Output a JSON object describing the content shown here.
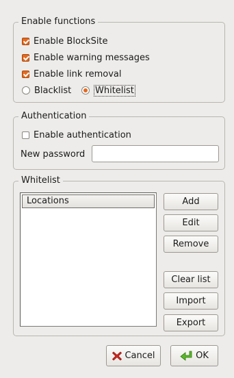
{
  "enable_functions": {
    "title": "Enable functions",
    "enable_blocksite": {
      "label": "Enable BlockSite",
      "checked": true
    },
    "enable_warning": {
      "label": "Enable warning messages",
      "checked": true
    },
    "enable_link_removal": {
      "label": "Enable link removal",
      "checked": true
    },
    "mode": {
      "blacklist_label": "Blacklist",
      "whitelist_label": "Whitelist",
      "selected": "Whitelist"
    }
  },
  "authentication": {
    "title": "Authentication",
    "enable_auth": {
      "label": "Enable authentication",
      "checked": false
    },
    "password_label": "New password",
    "password_value": ""
  },
  "whitelist": {
    "title": "Whitelist",
    "column_header": "Locations",
    "rows": [],
    "buttons": {
      "add": "Add",
      "edit": "Edit",
      "remove": "Remove",
      "clear": "Clear list",
      "import": "Import",
      "export": "Export"
    }
  },
  "dialog_buttons": {
    "cancel": "Cancel",
    "ok": "OK"
  },
  "icons": {
    "cancel": "red-x-icon",
    "ok": "green-arrow-icon"
  },
  "colors": {
    "accent": "#e46a1f",
    "window_bg": "#edecea"
  }
}
